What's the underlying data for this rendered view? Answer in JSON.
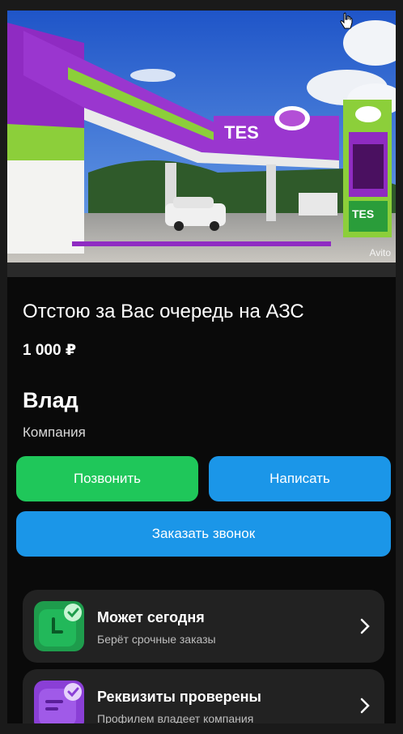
{
  "listing": {
    "title": "Отстою за Вас очередь на АЗС",
    "price": "1 000 ₽",
    "photo": {
      "station_brand": "TES",
      "pump_brand": "TES",
      "watermark": "Avito"
    }
  },
  "seller": {
    "name": "Влад",
    "type": "Компания"
  },
  "buttons": {
    "call_label": "Позвонить",
    "write_label": "Написать",
    "order_call_label": "Заказать звонок"
  },
  "cards": [
    {
      "title": "Может сегодня",
      "subtitle": "Берёт срочные заказы",
      "icon": "clock-check-icon"
    },
    {
      "title": "Реквизиты проверены",
      "subtitle": "Профилем владеет компания",
      "icon": "document-check-icon"
    }
  ],
  "colors": {
    "call_button": "#1fc75a",
    "write_button": "#1b96e8",
    "order_button": "#1b96e8",
    "background": "#0a0a0a",
    "card": "#222222"
  }
}
